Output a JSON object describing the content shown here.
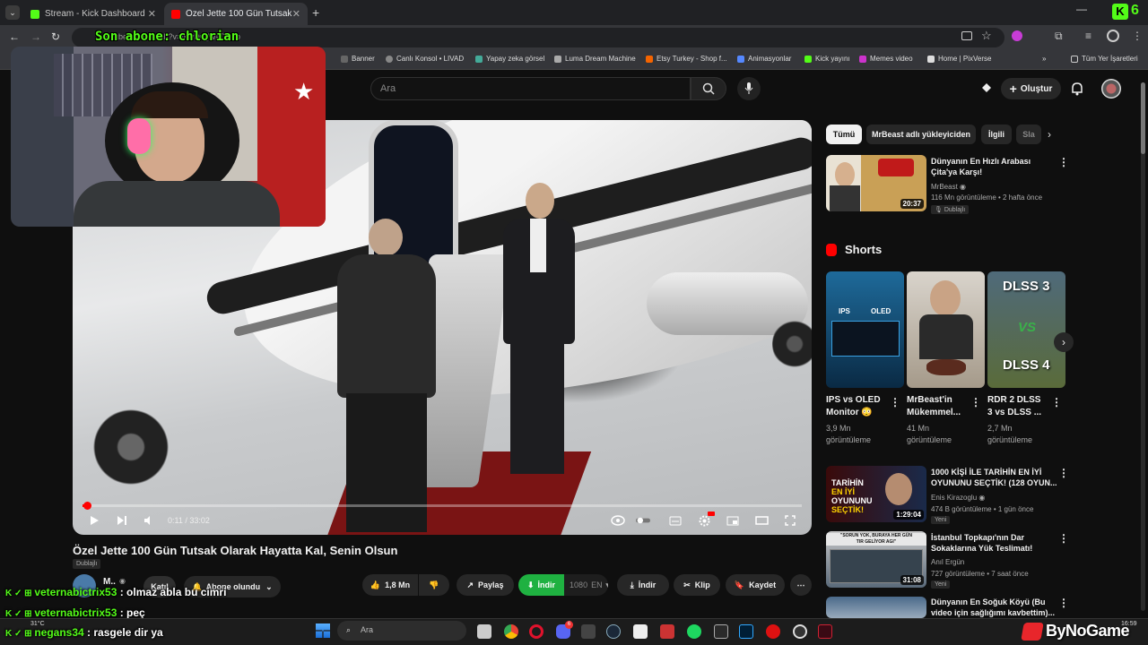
{
  "browser": {
    "tabs": [
      {
        "label": "Stream - Kick Dashboard",
        "active": false
      },
      {
        "label": "Özel Jette 100 Gün Tutsak Olar",
        "active": true
      }
    ],
    "url": "youtube.com/watch?v=mwDmjWaDE7o",
    "bookmarks": [
      "Banner",
      "Canlı Konsol • LIVAD",
      "Yapay zeka görsel",
      "Luma Dream Machine",
      "Etsy Turkey - Shop f...",
      "Animasyonlar",
      "Kick yayını",
      "Memes video",
      "Home | PixVerse"
    ],
    "all_bookmarks": "Tüm Yer İşaretleri",
    "kick_count": "6"
  },
  "overlay": {
    "sub_ticker": "Son abone: chlorian"
  },
  "youtube": {
    "search_placeholder": "Ara",
    "create_label": "Oluştur",
    "player": {
      "current_time": "0:11",
      "duration": "33:02",
      "time_text": "0:11 / 33:02",
      "progress": 0.006
    },
    "title": "Özel Jette 100 Gün Tutsak Olarak Hayatta Kal, Senin Olsun",
    "dub_badge": "Dublajlı",
    "channel_initial": "M..",
    "join_label": "Katıl",
    "subscribed_label": "Abone olundu",
    "likes": "1,8 Mn",
    "share_label": "Paylaş",
    "download_label": "İndir",
    "quality": "1080",
    "lang": "EN",
    "download2_label": "İndir",
    "clip_label": "Klip",
    "save_label": "Kaydet"
  },
  "sidebar": {
    "chips": [
      "Tümü",
      "MrBeast adlı yükleyiciden",
      "İlgili",
      "Sla"
    ],
    "top_video": {
      "title_line1": "Dünyanın En Hızlı Arabası",
      "title_line2": "Çita'ya Karşı!",
      "channel": "MrBeast",
      "meta": "116 Mn görüntüleme • 2 hafta önce",
      "badge": "Dublajlı",
      "duration": "20:37"
    },
    "shorts_heading": "Shorts",
    "shorts": [
      {
        "title1": "IPS vs OLED",
        "title2": "Monitor 😳",
        "views1": "3,9 Mn",
        "views2": "görüntüleme",
        "thumb_top": "IPS",
        "thumb_right": "OLED"
      },
      {
        "title1": "MrBeast'in",
        "title2": "Mükemmel...",
        "views1": "41 Mn",
        "views2": "görüntüleme"
      },
      {
        "title1": "RDR 2 DLSS",
        "title2": "3 vs DLSS ...",
        "views1": "2,7 Mn",
        "views2": "görüntüleme",
        "thumb_top": "DLSS 3",
        "thumb_mid": "VS",
        "thumb_bottom": "DLSS 4"
      }
    ],
    "videos": [
      {
        "title_line1": "1000 KİŞİ İLE TARİHİN EN İYİ",
        "title_line2": "OYUNUNU SEÇTİK! (128 OYUN...",
        "channel": "Enis Kirazoglu",
        "meta": "474 B görüntüleme • 1 gün önce",
        "badge": "Yeni",
        "duration": "1:29:04",
        "thumb_text1": "TARİHİN",
        "thumb_text2": "EN İYİ",
        "thumb_text3": "OYUNUNU",
        "thumb_text4": "SEÇTİK!"
      },
      {
        "title_line1": "İstanbul Topkapı'nın Dar",
        "title_line2": "Sokaklarına Yük Teslimatı!",
        "channel": "Anıl Ergün",
        "meta": "727 görüntüleme • 7 saat önce",
        "badge": "Yeni",
        "duration": "31:08",
        "thumb_text1": "\"SORUN YOK, BURAYA HER GÜN",
        "thumb_text2": "TIR GELİYOR AGI\""
      },
      {
        "title_line1": "Dünyanın En Soğuk Köyü (Bu",
        "title_line2": "video için sağlığımı kavbettim)..."
      }
    ]
  },
  "chat": [
    {
      "user": "veternabictrix53",
      "message": " : olmaz abla bu cimri"
    },
    {
      "user": "veternabictrix53",
      "message": " : peç"
    },
    {
      "user": "negans34",
      "message": " : rasgele dir ya"
    }
  ],
  "taskbar": {
    "search": "Ara",
    "weather": "31°C",
    "time": "16:59",
    "discord_badge": "6"
  },
  "watermark": "ByNoGame"
}
